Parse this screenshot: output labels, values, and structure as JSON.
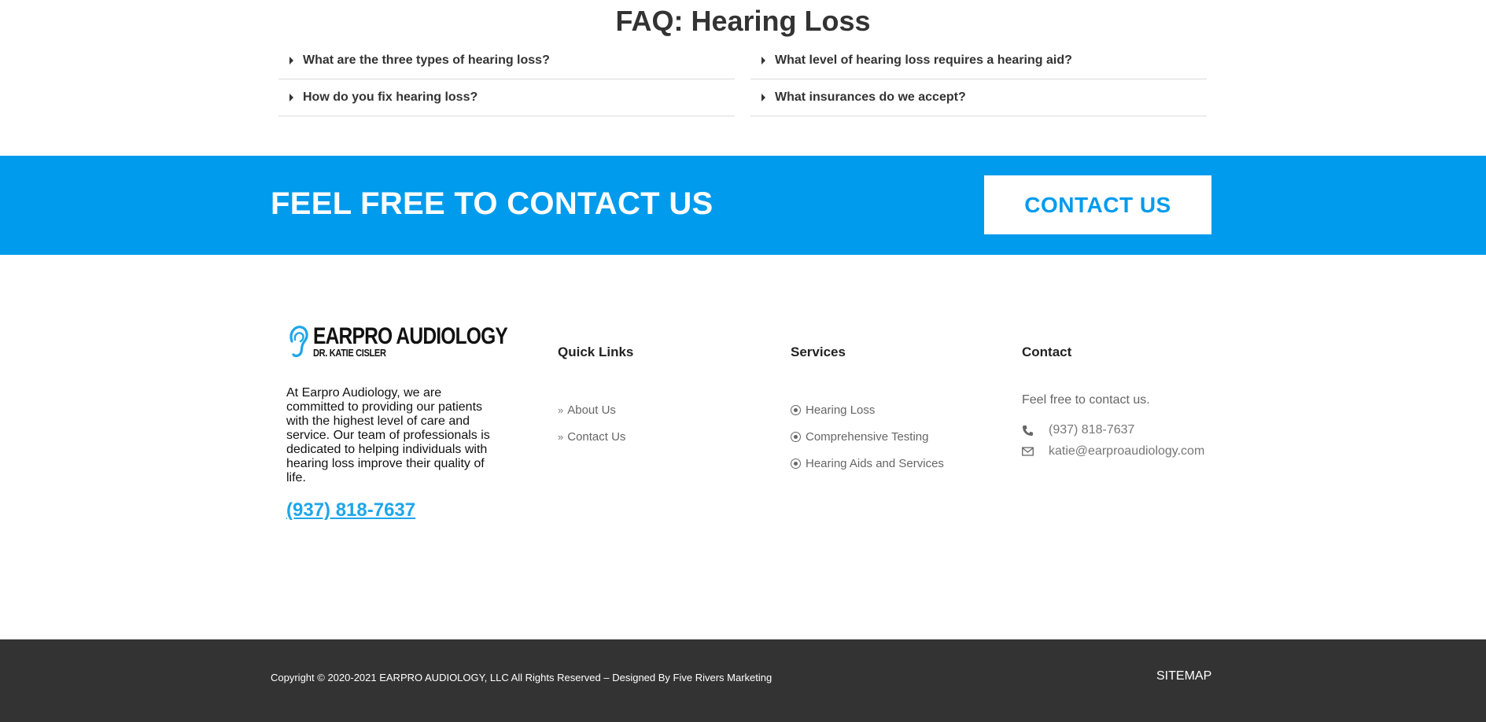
{
  "faq": {
    "title": "FAQ: Hearing Loss",
    "left": [
      "What are the three types of hearing loss?",
      "How do you fix hearing loss?"
    ],
    "right": [
      "What level of hearing loss requires a hearing aid?",
      "What insurances do we accept?"
    ]
  },
  "cta": {
    "text": "FEEL FREE TO CONTACT US",
    "button": "CONTACT US",
    "bg_color": "#009bec"
  },
  "footer": {
    "logo": {
      "name": "EARPRO AUDIOLOGY",
      "sub": "DR. KATIE CISLER",
      "icon": "ear-icon"
    },
    "about": "At Earpro Audiology, we are committed to providing our patients with the highest level of care and service. Our team of professionals is dedicated to helping individuals with hearing loss improve their quality of life.",
    "phone": "(937) 818-7637",
    "quick_links": {
      "heading": "Quick Links",
      "items": [
        "About Us",
        "Contact Us"
      ]
    },
    "services": {
      "heading": "Services",
      "items": [
        "Hearing Loss",
        "Comprehensive Testing",
        "Hearing Aids and Services"
      ]
    },
    "contact": {
      "heading": "Contact",
      "lead": "Feel free to contact us.",
      "phone": "(937) 818-7637",
      "email": "katie@earproaudiology.com"
    }
  },
  "bottom": {
    "copyright": "Copyright © 2020-2021 EARPRO AUDIOLOGY, LLC All Rights Reserved – Designed By Five Rivers Marketing",
    "sitemap": "SITEMAP",
    "bg_color": "#333333"
  }
}
